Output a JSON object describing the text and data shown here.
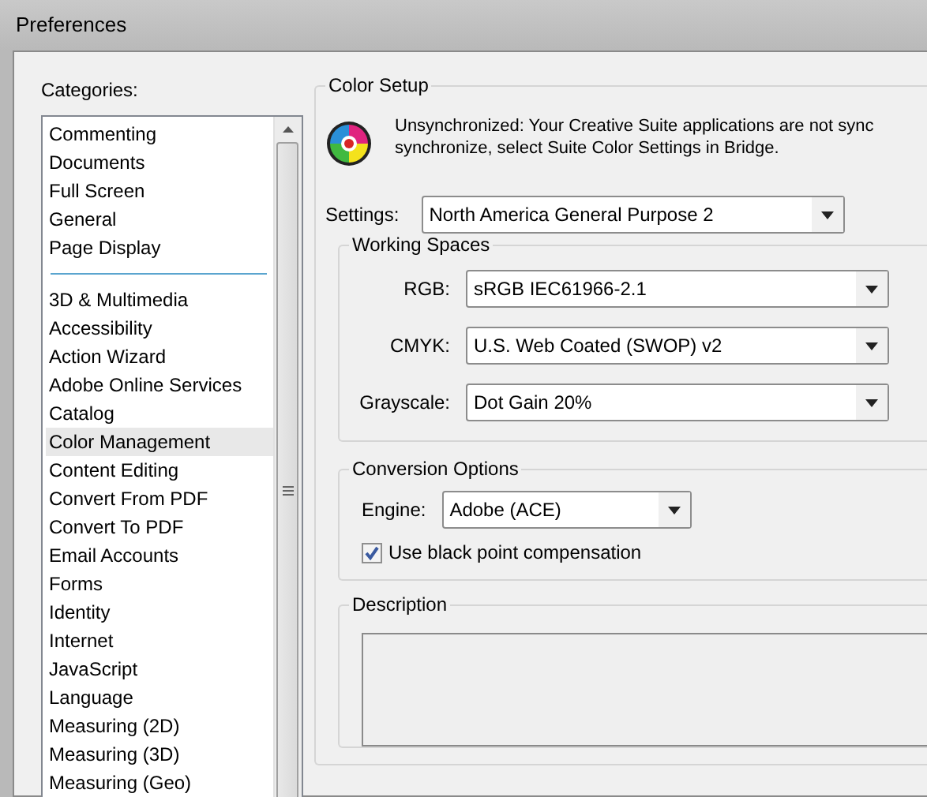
{
  "window": {
    "title": "Preferences"
  },
  "categories": {
    "label": "Categories:",
    "items": [
      {
        "kind": "item",
        "label": "Commenting",
        "selected": false
      },
      {
        "kind": "item",
        "label": "Documents",
        "selected": false
      },
      {
        "kind": "item",
        "label": "Full Screen",
        "selected": false
      },
      {
        "kind": "item",
        "label": "General",
        "selected": false
      },
      {
        "kind": "item",
        "label": "Page Display",
        "selected": false
      },
      {
        "kind": "separator"
      },
      {
        "kind": "item",
        "label": "3D & Multimedia",
        "selected": false
      },
      {
        "kind": "item",
        "label": "Accessibility",
        "selected": false
      },
      {
        "kind": "item",
        "label": "Action Wizard",
        "selected": false
      },
      {
        "kind": "item",
        "label": "Adobe Online Services",
        "selected": false
      },
      {
        "kind": "item",
        "label": "Catalog",
        "selected": false
      },
      {
        "kind": "item",
        "label": "Color Management",
        "selected": true
      },
      {
        "kind": "item",
        "label": "Content Editing",
        "selected": false
      },
      {
        "kind": "item",
        "label": "Convert From PDF",
        "selected": false
      },
      {
        "kind": "item",
        "label": "Convert To PDF",
        "selected": false
      },
      {
        "kind": "item",
        "label": "Email Accounts",
        "selected": false
      },
      {
        "kind": "item",
        "label": "Forms",
        "selected": false
      },
      {
        "kind": "item",
        "label": "Identity",
        "selected": false
      },
      {
        "kind": "item",
        "label": "Internet",
        "selected": false
      },
      {
        "kind": "item",
        "label": "JavaScript",
        "selected": false
      },
      {
        "kind": "item",
        "label": "Language",
        "selected": false
      },
      {
        "kind": "item",
        "label": "Measuring (2D)",
        "selected": false
      },
      {
        "kind": "item",
        "label": "Measuring (3D)",
        "selected": false
      },
      {
        "kind": "item",
        "label": "Measuring (Geo)",
        "selected": false
      }
    ]
  },
  "color_setup": {
    "title": "Color Setup",
    "message": [
      "Unsynchronized: Your Creative Suite applications are not sync",
      "synchronize, select Suite Color Settings in Bridge."
    ],
    "settings": {
      "label": "Settings:",
      "value": "North America General Purpose 2"
    },
    "working_spaces": {
      "title": "Working Spaces",
      "fields": [
        {
          "label": "RGB:",
          "value": "sRGB IEC61966-2.1"
        },
        {
          "label": "CMYK:",
          "value": "U.S. Web Coated (SWOP) v2"
        },
        {
          "label": "Grayscale:",
          "value": "Dot Gain 20%"
        }
      ]
    },
    "conversion_options": {
      "title": "Conversion Options",
      "engine": {
        "label": "Engine:",
        "value": "Adobe (ACE)"
      },
      "black_point": {
        "label": "Use black point compensation",
        "checked": true
      }
    },
    "description": {
      "title": "Description"
    }
  }
}
